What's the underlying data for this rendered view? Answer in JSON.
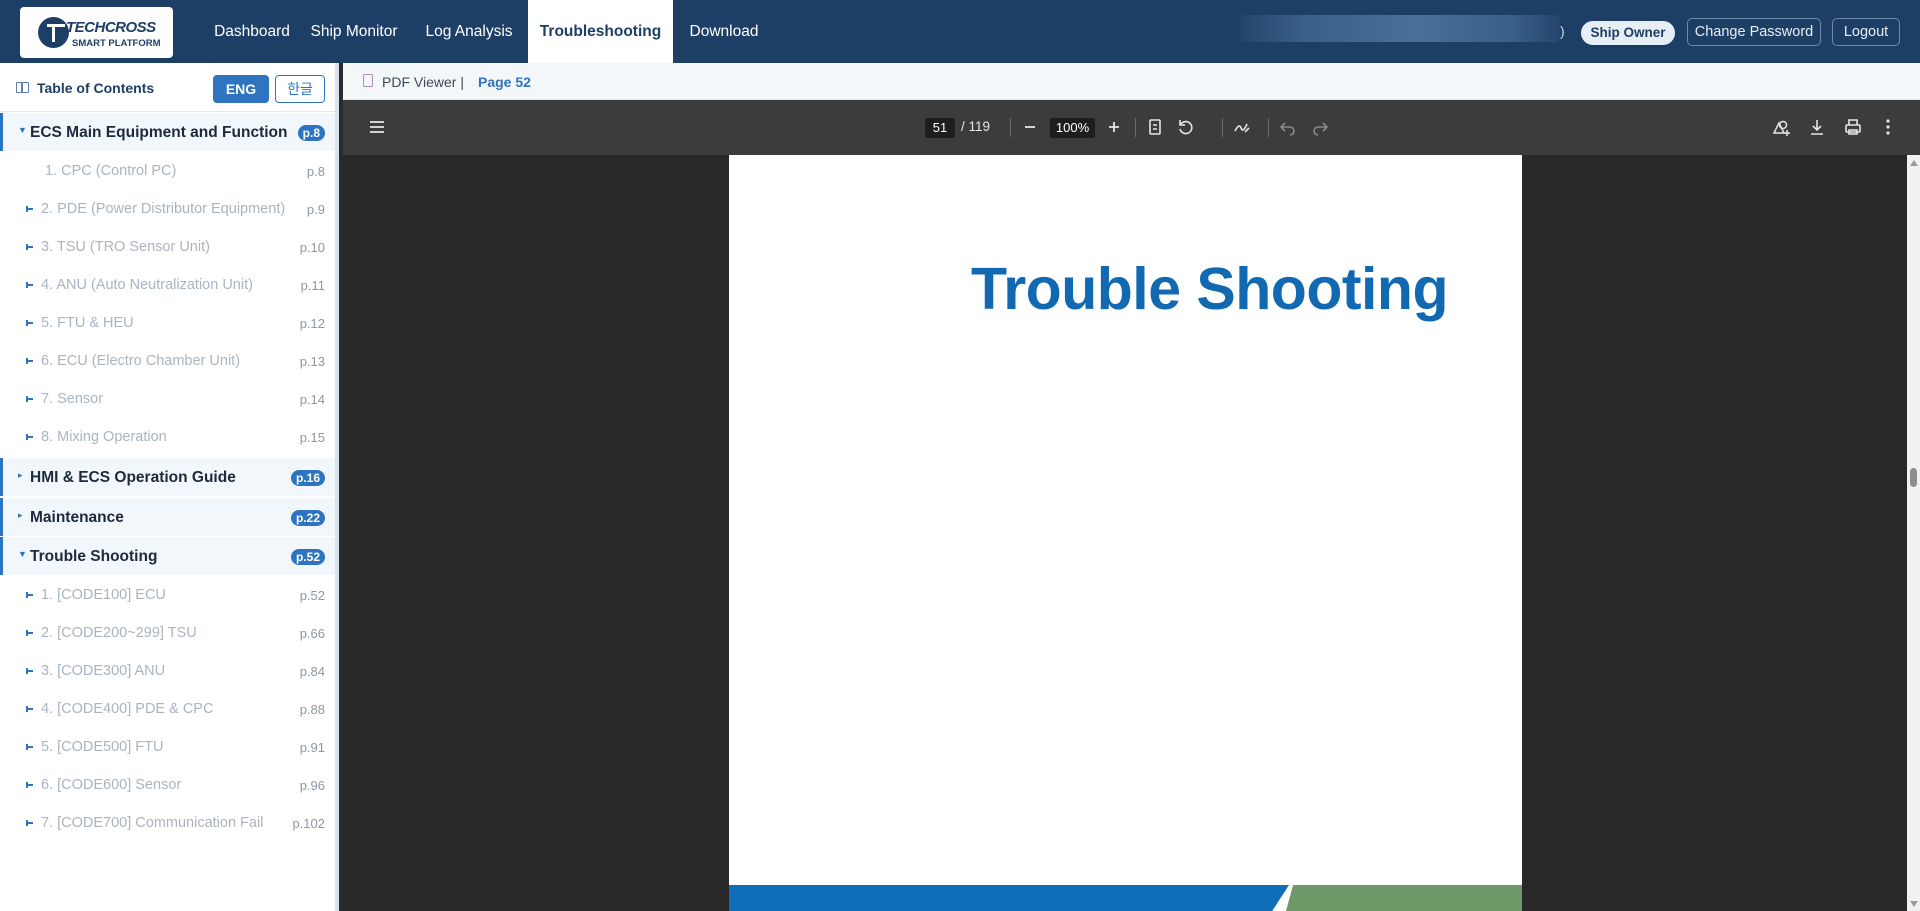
{
  "logo": {
    "main": "TECHCROSS",
    "sub": "SMART PLATFORM"
  },
  "nav": {
    "items": [
      {
        "label": "Dashboard"
      },
      {
        "label": "Ship Monitor"
      },
      {
        "label": "Log Analysis"
      },
      {
        "label": "Troubleshooting",
        "active": true
      },
      {
        "label": "Download"
      }
    ],
    "user_suffix": ")",
    "role": "Ship Owner",
    "change_password": "Change Password",
    "logout": "Logout"
  },
  "toc": {
    "title": "Table of Contents",
    "lang_eng": "ENG",
    "lang_kor": "한글",
    "sections": [
      {
        "label": "ECS Main Equipment and Function",
        "page": "p.8",
        "expanded": true,
        "items": [
          {
            "label": "1. CPC (Control PC)",
            "page": "p.8"
          },
          {
            "label": "2. PDE (Power Distributor Equipment)",
            "page": "p.9"
          },
          {
            "label": "3. TSU (TRO Sensor Unit)",
            "page": "p.10"
          },
          {
            "label": "4. ANU (Auto Neutralization Unit)",
            "page": "p.11"
          },
          {
            "label": "5. FTU & HEU",
            "page": "p.12"
          },
          {
            "label": "6. ECU (Electro Chamber Unit)",
            "page": "p.13"
          },
          {
            "label": "7. Sensor",
            "page": "p.14"
          },
          {
            "label": "8. Mixing Operation",
            "page": "p.15"
          }
        ]
      },
      {
        "label": "HMI & ECS Operation Guide",
        "page": "p.16",
        "expanded": false,
        "items": []
      },
      {
        "label": "Maintenance",
        "page": "p.22",
        "expanded": false,
        "items": []
      },
      {
        "label": "Trouble Shooting",
        "page": "p.52",
        "expanded": true,
        "items": [
          {
            "label": "1. [CODE100] ECU",
            "page": "p.52"
          },
          {
            "label": "2. [CODE200~299] TSU",
            "page": "p.66"
          },
          {
            "label": "3. [CODE300] ANU",
            "page": "p.84"
          },
          {
            "label": "4. [CODE400] PDE & CPC",
            "page": "p.88"
          },
          {
            "label": "5. [CODE500] FTU",
            "page": "p.91"
          },
          {
            "label": "6. [CODE600] Sensor",
            "page": "p.96"
          },
          {
            "label": "7. [CODE700] Communication Fail",
            "page": "p.102"
          }
        ]
      }
    ]
  },
  "viewer": {
    "label": "PDF Viewer  |",
    "page_label": "Page 52"
  },
  "pdf": {
    "current_page": "51",
    "total_pages": "/ 119",
    "zoom": "100%",
    "page_title": "Trouble Shooting",
    "band_colors": [
      "#0d6db6",
      "#6e9a6a"
    ]
  },
  "icons": [
    "book-icon",
    "document-icon",
    "menu-icon",
    "zoom-out-icon",
    "zoom-in-icon",
    "fit-page-icon",
    "rotate-icon",
    "draw-icon",
    "undo-icon",
    "redo-icon",
    "add-shape-icon",
    "download-icon",
    "print-icon",
    "more-icon"
  ]
}
